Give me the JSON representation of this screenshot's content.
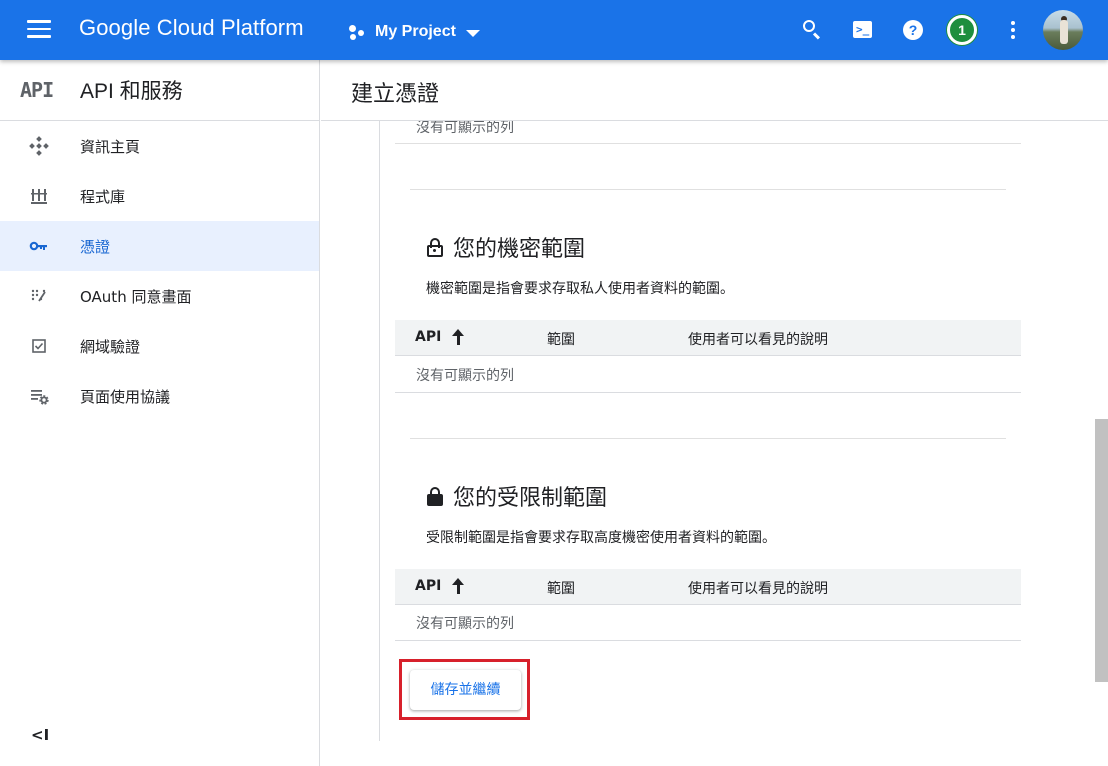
{
  "topbar": {
    "brand": "Google Cloud Platform",
    "project_name": "My Project",
    "notification_count": "1",
    "help_glyph": "?",
    "terminal_glyph": ">_",
    "icons": [
      "menu-icon",
      "project-icon",
      "search-icon",
      "terminal-icon",
      "help-icon",
      "more-vert-icon"
    ]
  },
  "sidebar": {
    "logo_text": "API",
    "title": "API 和服務",
    "items": [
      {
        "label": "資訊主頁",
        "icon": "dashboard-icon"
      },
      {
        "label": "程式庫",
        "icon": "library-icon"
      },
      {
        "label": "憑證",
        "icon": "key-icon",
        "active": true
      },
      {
        "label": "OAuth 同意畫面",
        "icon": "consent-icon"
      },
      {
        "label": "網域驗證",
        "icon": "checkbox-icon"
      },
      {
        "label": "頁面使用協議",
        "icon": "settings-list-icon"
      }
    ],
    "collapse_glyph": "<I"
  },
  "main": {
    "page_title": "建立憑證",
    "previous_empty": "沒有可顯示的列",
    "sensitive": {
      "title": "您的機密範圍",
      "description": "機密範圍是指會要求存取私人使用者資料的範圍。",
      "columns": [
        "API",
        "範圍",
        "使用者可以看見的說明"
      ],
      "empty": "沒有可顯示的列"
    },
    "restricted": {
      "title": "您的受限制範圍",
      "description": "受限制範圍是指會要求存取高度機密使用者資料的範圍。",
      "columns": [
        "API",
        "範圍",
        "使用者可以看見的說明"
      ],
      "empty": "沒有可顯示的列"
    },
    "save_button": "儲存並繼續"
  },
  "colors": {
    "topbar": "#1a73e8",
    "active_nav_bg": "#e8f0fe",
    "active_nav_text": "#1967d2",
    "highlight_box": "#d7202b",
    "notification_badge": "#1e8e3e"
  }
}
